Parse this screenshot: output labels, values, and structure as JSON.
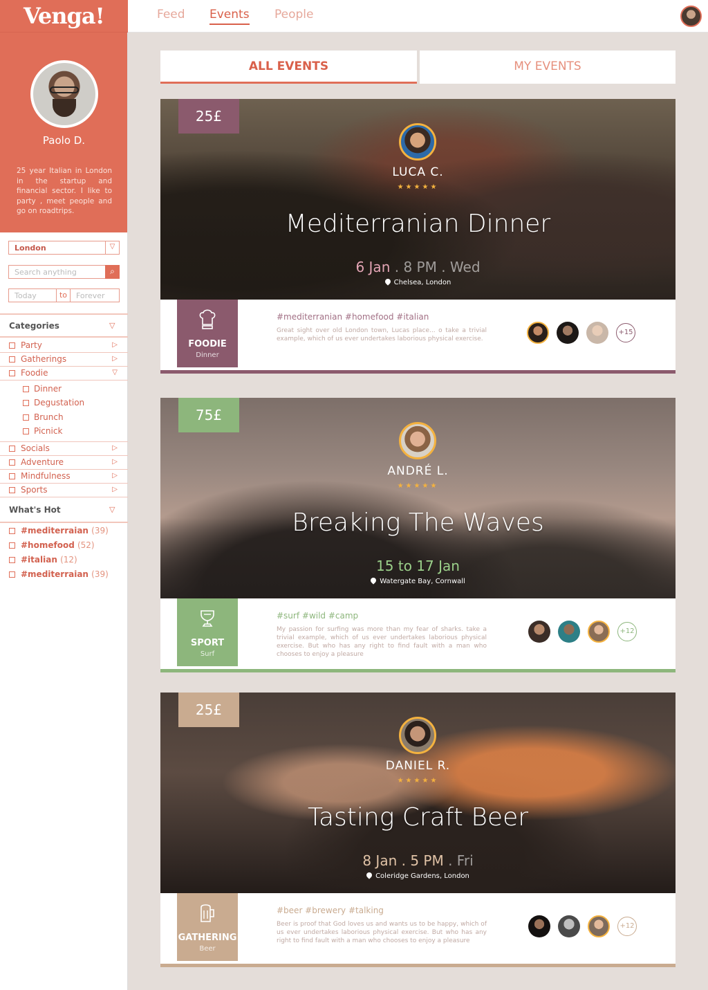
{
  "brand": "Venga!",
  "nav": {
    "feed": "Feed",
    "events": "Events",
    "people": "People"
  },
  "profile": {
    "name": "Paolo D.",
    "bio": "25 year Italian in London in the startup and financial sector. I like to party , meet people and go on roadtrips."
  },
  "filters": {
    "location": "London",
    "search_placeholder": "Search anything",
    "date_from": "Today",
    "date_to_label": "to",
    "date_until": "Forever"
  },
  "categories": {
    "title": "Categories",
    "items": [
      "Party",
      "Gatherings",
      "Foodie",
      "Socials",
      "Adventure",
      "Mindfulness",
      "Sports"
    ],
    "foodie_sub": [
      "Dinner",
      "Degustation",
      "Brunch",
      "Picnick"
    ]
  },
  "hot": {
    "title": "What's Hot",
    "items": [
      {
        "tag": "#mediterraian",
        "count": "(39)"
      },
      {
        "tag": "#homefood",
        "count": "(52)"
      },
      {
        "tag": "#italian",
        "count": "(12)"
      },
      {
        "tag": "#mediterraian",
        "count": "(39)"
      }
    ]
  },
  "tabs": {
    "all": "ALL EVENTS",
    "mine": "MY EVENTS"
  },
  "events": [
    {
      "price": "25£",
      "host": "LUCA C.",
      "stars": "★★★★★",
      "title": "Mediterranian Dinner",
      "date_main": "6 Jan",
      "date_rest": " . 8 PM . Wed",
      "place": "Chelsea, London",
      "category": "FOODIE",
      "subcategory": "Dinner",
      "tags": "#mediterranian #homefood #italian",
      "description": "Great sight over old London town, Lucas place... o take a trivial example, which of us ever undertakes laborious physical exercise.",
      "more": "+15",
      "accent": "#8b5a6d"
    },
    {
      "price": "75£",
      "host": "ANDRÉ L.",
      "stars": "★★★★★",
      "title": "Breaking The Waves",
      "date_main": "15 to 17 Jan",
      "date_rest": "",
      "place": "Watergate Bay, Cornwall",
      "category": "SPORT",
      "subcategory": "Surf",
      "tags": "#surf #wild #camp",
      "description": "My passion for surfing was more than my fear of sharks. take a trivial example, which of us ever undertakes laborious physical exercise. But who has any right to find fault with a man who chooses to enjoy a pleasure",
      "more": "+12",
      "accent": "#8db67c"
    },
    {
      "price": "25£",
      "host": "DANIEL R.",
      "stars": "★★★★★",
      "title": "Tasting Craft Beer",
      "date_main": "8 Jan . 5 PM",
      "date_rest": " . Fri",
      "place": "Coleridge Gardens, London",
      "category": "GATHERING",
      "subcategory": "Beer",
      "tags": "#beer #brewery #talking",
      "description": "Beer is proof that God loves us and wants us to be happy, which of us ever undertakes laborious physical exercise. But who has any right to find fault with a man who chooses to enjoy a pleasure",
      "more": "+12",
      "accent": "#c9ab90"
    }
  ],
  "icons": [
    "dropdown-icon",
    "search-icon",
    "caret-down-icon",
    "caret-right-icon",
    "location-pin-icon",
    "chef-hat-icon",
    "trophy-icon",
    "beer-mug-icon"
  ]
}
